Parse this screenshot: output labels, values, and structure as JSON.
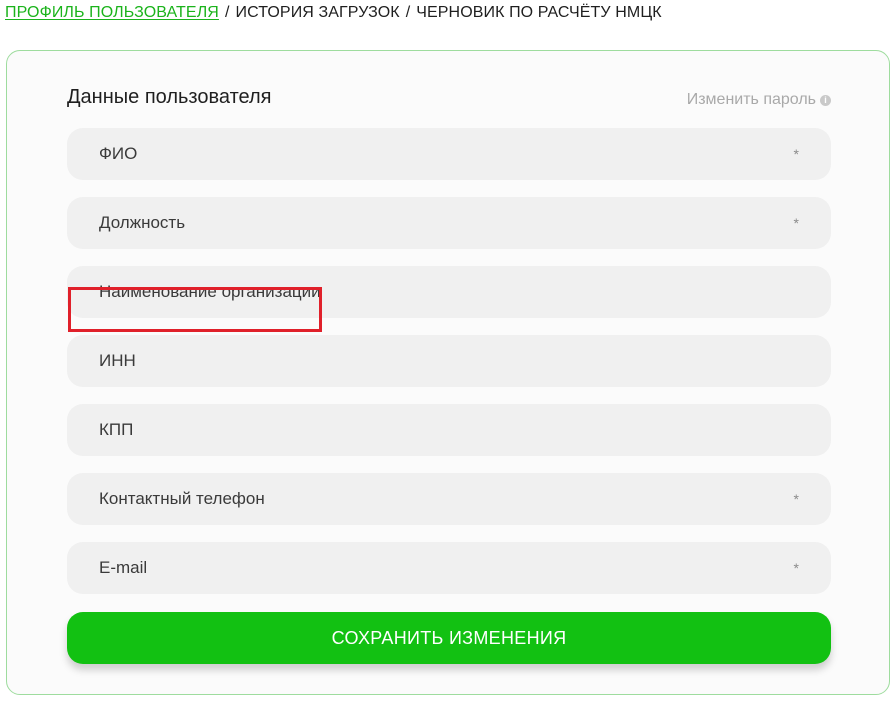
{
  "breadcrumb": {
    "items": [
      {
        "label": "ПРОФИЛЬ ПОЛЬЗОВАТЕЛЯ"
      },
      {
        "label": "ИСТОРИЯ ЗАГРУЗОК"
      },
      {
        "label": "ЧЕРНОВИК ПО РАСЧЁТУ НМЦК"
      }
    ],
    "separator": "/"
  },
  "card": {
    "title": "Данные пользователя",
    "change_password": "Изменить пароль",
    "info_icon": "info-icon"
  },
  "fields": [
    {
      "label": "ФИО",
      "required_mark": "*"
    },
    {
      "label": "Должность",
      "required_mark": "*"
    },
    {
      "label": "Наименование организации",
      "required_mark": ""
    },
    {
      "label": "ИНН",
      "required_mark": ""
    },
    {
      "label": "КПП",
      "required_mark": ""
    },
    {
      "label": "Контактный телефон",
      "required_mark": "*"
    },
    {
      "label": "E-mail",
      "required_mark": "*"
    }
  ],
  "save_button": {
    "label": "СОХРАНИТЬ ИЗМЕНЕНИЯ"
  },
  "colors": {
    "accent": "#12c112",
    "link": "#1bb31b",
    "highlight": "#e0202a"
  }
}
